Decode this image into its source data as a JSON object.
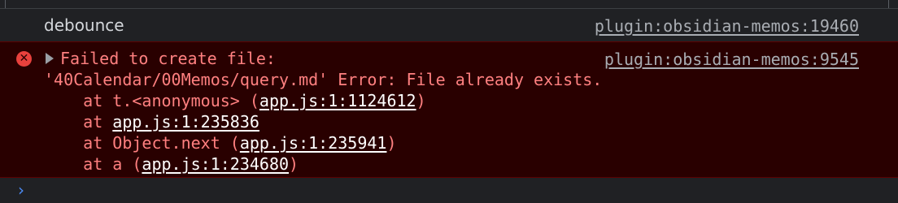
{
  "log_entry": {
    "message": "debounce",
    "source": "plugin:obsidian-memos:19460"
  },
  "error_entry": {
    "source": "plugin:obsidian-memos:9545",
    "message_line1": "Failed to create file:",
    "message_line2": "'40Calendar/00Memos/query.md' Error: File already exists.",
    "stack": [
      {
        "prefix": "    at t.<anonymous> (",
        "link": "app.js:1:1124612",
        "suffix": ")"
      },
      {
        "prefix": "    at ",
        "link": "app.js:1:235836",
        "suffix": ""
      },
      {
        "prefix": "    at Object.next (",
        "link": "app.js:1:235941",
        "suffix": ")"
      },
      {
        "prefix": "    at a (",
        "link": "app.js:1:234680",
        "suffix": ")"
      }
    ]
  },
  "icons": {
    "error": "error-circle-x",
    "expand": "triangle-right",
    "prompt": "chevron-right"
  },
  "colors": {
    "background": "#202124",
    "error_background": "#290000",
    "error_text": "#ff8080",
    "error_icon": "#e8413d",
    "prompt": "#4c8bf5"
  }
}
